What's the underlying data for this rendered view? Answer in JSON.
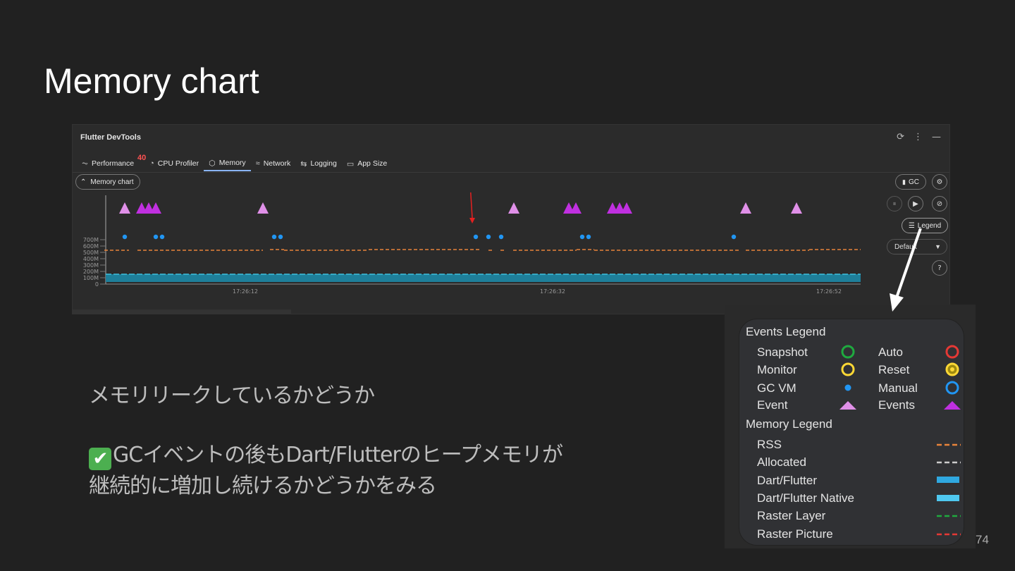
{
  "slide": {
    "title": "Memory chart",
    "line1": "メモリリークしているかどうか",
    "line2": "GCイベントの後もDart/Flutterのヒープメモリが",
    "line3": "継続的に増加し続けるかどうかをみる",
    "check_glyph": "✔",
    "page_number": "74"
  },
  "devtools": {
    "title": "Flutter DevTools",
    "tabs": [
      {
        "label": "Performance",
        "icon": "performance-icon"
      },
      {
        "label": "CPU Profiler",
        "icon": "gauge-icon"
      },
      {
        "label": "Memory",
        "icon": "cube-icon"
      },
      {
        "label": "Network",
        "icon": "wifi-icon"
      },
      {
        "label": "Logging",
        "icon": "logging-icon"
      },
      {
        "label": "App Size",
        "icon": "folder-icon"
      }
    ],
    "badge": "40",
    "memory_chart_button": "Memory chart",
    "gc_button": "GC",
    "legend_button": "Legend",
    "interval_select": "Default",
    "accent": "#8ab4f8"
  },
  "chart_data": {
    "type": "line",
    "y_ticks": [
      "700M",
      "600M",
      "500M",
      "400M",
      "300M",
      "200M",
      "100M",
      "0"
    ],
    "x_ticks": [
      "17:26:12",
      "17:26:32",
      "17:26:52"
    ],
    "series": [
      {
        "name": "RSS",
        "color": "#e8833a",
        "approx_value_M": 545
      },
      {
        "name": "Dart/Flutter",
        "color": "#2a8fb0",
        "approx_value_M": 130
      }
    ],
    "events": "triangles (purple) and GC VM dots (blue) along the top track"
  },
  "legend": {
    "events_title": "Events Legend",
    "memory_title": "Memory Legend",
    "events": [
      {
        "label": "Snapshot",
        "color": "#1faa3f"
      },
      {
        "label": "Auto",
        "color": "#e53935"
      },
      {
        "label": "Monitor",
        "color": "#fdd835"
      },
      {
        "label": "Reset",
        "color": "#fdd835"
      },
      {
        "label": "GC VM",
        "color": "#2196f3"
      },
      {
        "label": "Manual",
        "color": "#2196f3"
      },
      {
        "label": "Event",
        "color": "#e090e8"
      },
      {
        "label": "Events",
        "color": "#c030e0"
      }
    ],
    "memory": [
      {
        "label": "RSS",
        "color": "#e8833a"
      },
      {
        "label": "Allocated",
        "color": "#cccccc"
      },
      {
        "label": "Dart/Flutter",
        "color": "#2fa8e0"
      },
      {
        "label": "Dart/Flutter Native",
        "color": "#4fc8f0"
      },
      {
        "label": "Raster Layer",
        "color": "#1faa3f"
      },
      {
        "label": "Raster Picture",
        "color": "#e53935"
      }
    ]
  }
}
